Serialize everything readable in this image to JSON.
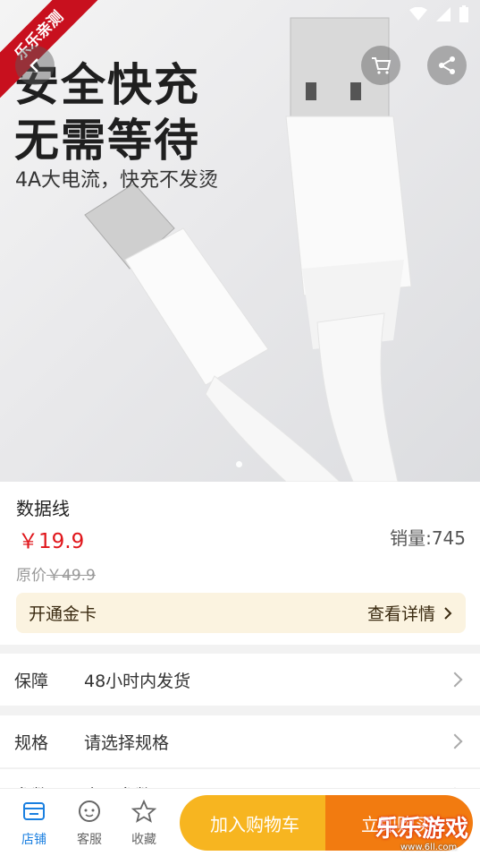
{
  "badge": "乐乐亲测",
  "hero": {
    "title_line1": "安全快充",
    "title_line2": "无需等待",
    "subtitle": "4A大电流，快充不发烫"
  },
  "product": {
    "name": "数据线",
    "price": "￥19.9",
    "sales": "销量:745",
    "original_label": "原价",
    "original_price": "￥49.9"
  },
  "gold_card": {
    "label": "开通金卡",
    "action": "查看详情"
  },
  "rows": [
    {
      "key": "保障",
      "value": "48小时内发货"
    },
    {
      "key": "规格",
      "value": "请选择规格"
    },
    {
      "key": "参数",
      "value": "产品参数"
    }
  ],
  "tabs": [
    {
      "label": "店铺",
      "icon": "store-icon"
    },
    {
      "label": "客服",
      "icon": "customer-service-icon"
    },
    {
      "label": "收藏",
      "icon": "star-icon"
    }
  ],
  "buttons": {
    "add_to_cart": "加入购物车",
    "buy_now": "立即购买"
  },
  "watermark": {
    "text": "乐乐游戏",
    "url": "www.6ll.com"
  },
  "colors": {
    "price": "#e0161b",
    "accent_tab": "#1a7fe0",
    "cart_button": "#f7b520",
    "buy_button": "#f27b10",
    "badge": "#c8101e"
  }
}
